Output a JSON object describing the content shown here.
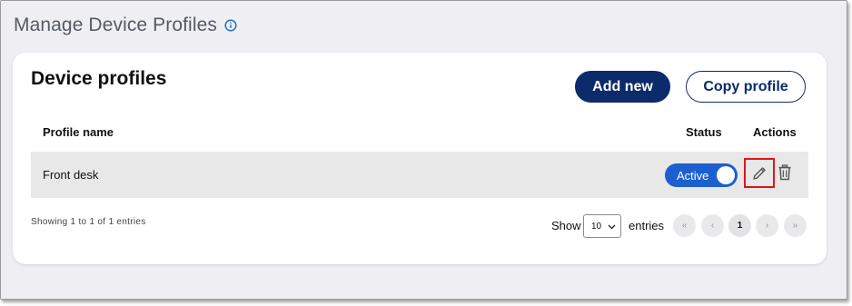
{
  "header": {
    "title": "Manage Device Profiles",
    "info_icon": "info-icon"
  },
  "card": {
    "title": "Device profiles",
    "add_label": "Add new",
    "copy_label": "Copy profile"
  },
  "table": {
    "columns": [
      "Profile name",
      "Status",
      "Actions"
    ],
    "rows": [
      {
        "name": "Front desk",
        "status": "Active",
        "status_on": true
      }
    ]
  },
  "footer": {
    "showing": "Showing 1 to 1 of 1 entries",
    "show_label": "Show",
    "page_size": "10",
    "entries_label": "entries",
    "pagination": {
      "first": "«",
      "prev": "‹",
      "current": "1",
      "next": "›",
      "last": "»"
    }
  },
  "icons": {
    "edit": "pencil-icon",
    "delete": "trash-icon",
    "select": "chevron-down-icon"
  },
  "colors": {
    "primary": "#0c2b6b",
    "toggle_on": "#1c5fcf",
    "highlight": "#e0141b",
    "info": "#1a73c9",
    "background": "#efeff3"
  }
}
